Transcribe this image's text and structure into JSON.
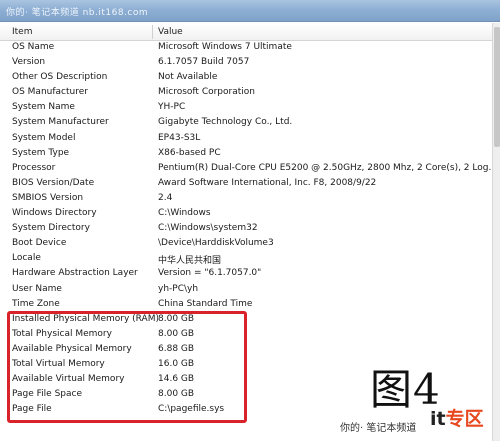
{
  "window": {
    "watermark": "你的· 笔记本频道 nb.it168.com"
  },
  "columns": {
    "item": "Item",
    "value": "Value"
  },
  "rows": [
    {
      "item": "OS Name",
      "value": "Microsoft Windows 7 Ultimate"
    },
    {
      "item": "Version",
      "value": "6.1.7057 Build 7057"
    },
    {
      "item": "Other OS Description",
      "value": "Not Available"
    },
    {
      "item": "OS Manufacturer",
      "value": "Microsoft Corporation"
    },
    {
      "item": "System Name",
      "value": "YH-PC"
    },
    {
      "item": "System Manufacturer",
      "value": "Gigabyte Technology Co., Ltd."
    },
    {
      "item": "System Model",
      "value": "EP43-S3L"
    },
    {
      "item": "System Type",
      "value": "X86-based PC"
    },
    {
      "item": "Processor",
      "value": "Pentium(R) Dual-Core  CPU      E5200  @ 2.50GHz, 2800 Mhz, 2 Core(s), 2 Log..."
    },
    {
      "item": "BIOS Version/Date",
      "value": "Award Software International, Inc. F8, 2008/9/22"
    },
    {
      "item": "SMBIOS Version",
      "value": "2.4"
    },
    {
      "item": "Windows Directory",
      "value": "C:\\Windows"
    },
    {
      "item": "System Directory",
      "value": "C:\\Windows\\system32"
    },
    {
      "item": "Boot Device",
      "value": "\\Device\\HarddiskVolume3"
    },
    {
      "item": "Locale",
      "value": "中华人民共和国"
    },
    {
      "item": "Hardware Abstraction Layer",
      "value": "Version = \"6.1.7057.0\""
    },
    {
      "item": "User Name",
      "value": "yh-PC\\yh"
    },
    {
      "item": "Time Zone",
      "value": "China Standard Time"
    },
    {
      "item": "Installed Physical Memory (RAM)",
      "value": "8.00 GB"
    },
    {
      "item": "Total Physical Memory",
      "value": "8.00 GB"
    },
    {
      "item": "Available Physical Memory",
      "value": "6.88 GB"
    },
    {
      "item": "Total Virtual Memory",
      "value": "16.0 GB"
    },
    {
      "item": "Available Virtual Memory",
      "value": "14.6 GB"
    },
    {
      "item": "Page File Space",
      "value": "8.00 GB"
    },
    {
      "item": "Page File",
      "value": "C:\\pagefile.sys"
    }
  ],
  "annotation": {
    "figure_label": "图4",
    "highlight_color": "#d9232a"
  },
  "footer": {
    "watermark": "你的· 笔记本频道",
    "brand_part1": "it",
    "brand_part2": "专区"
  }
}
